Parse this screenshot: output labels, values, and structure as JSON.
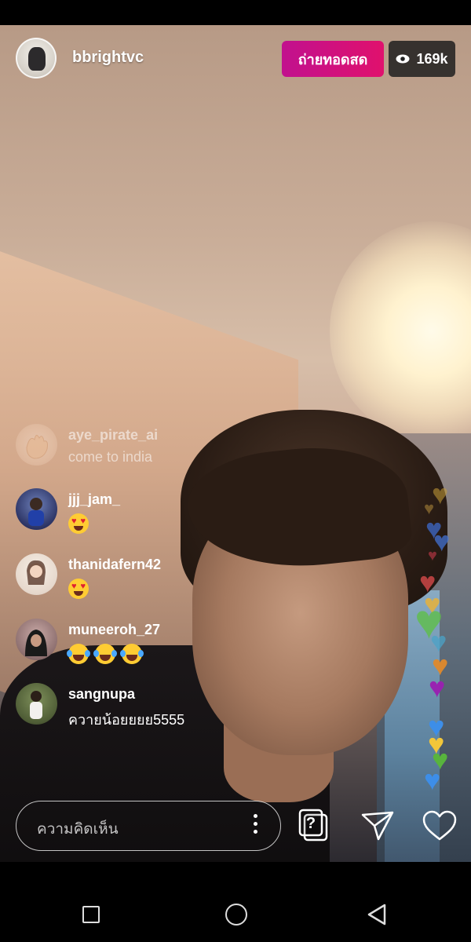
{
  "header": {
    "username": "bbrightvc",
    "live_label": "ถ่ายทอดสด",
    "viewer_count": "169k"
  },
  "comments": [
    {
      "username": "aye_pirate_ai",
      "text": "come to india",
      "faded": true
    },
    {
      "username": "jjj_jam_",
      "text": "",
      "emoji": [
        "heart-eyes"
      ]
    },
    {
      "username": "thanidafern42",
      "text": "",
      "emoji": [
        "heart-eyes"
      ]
    },
    {
      "username": "muneeroh_27",
      "text": "",
      "emoji": [
        "tears-of-joy",
        "tears-of-joy",
        "tears-of-joy"
      ]
    },
    {
      "username": "sangnupa",
      "text": "ควายน้อยยยย5555"
    }
  ],
  "bottom_bar": {
    "comment_placeholder": "ความคิดเห็น"
  },
  "icons": {
    "more": "more-vertical-icon",
    "questions": "question-sticker-icon",
    "share": "send-icon",
    "like": "heart-icon"
  },
  "colors": {
    "live_accent": "#d5117a"
  }
}
